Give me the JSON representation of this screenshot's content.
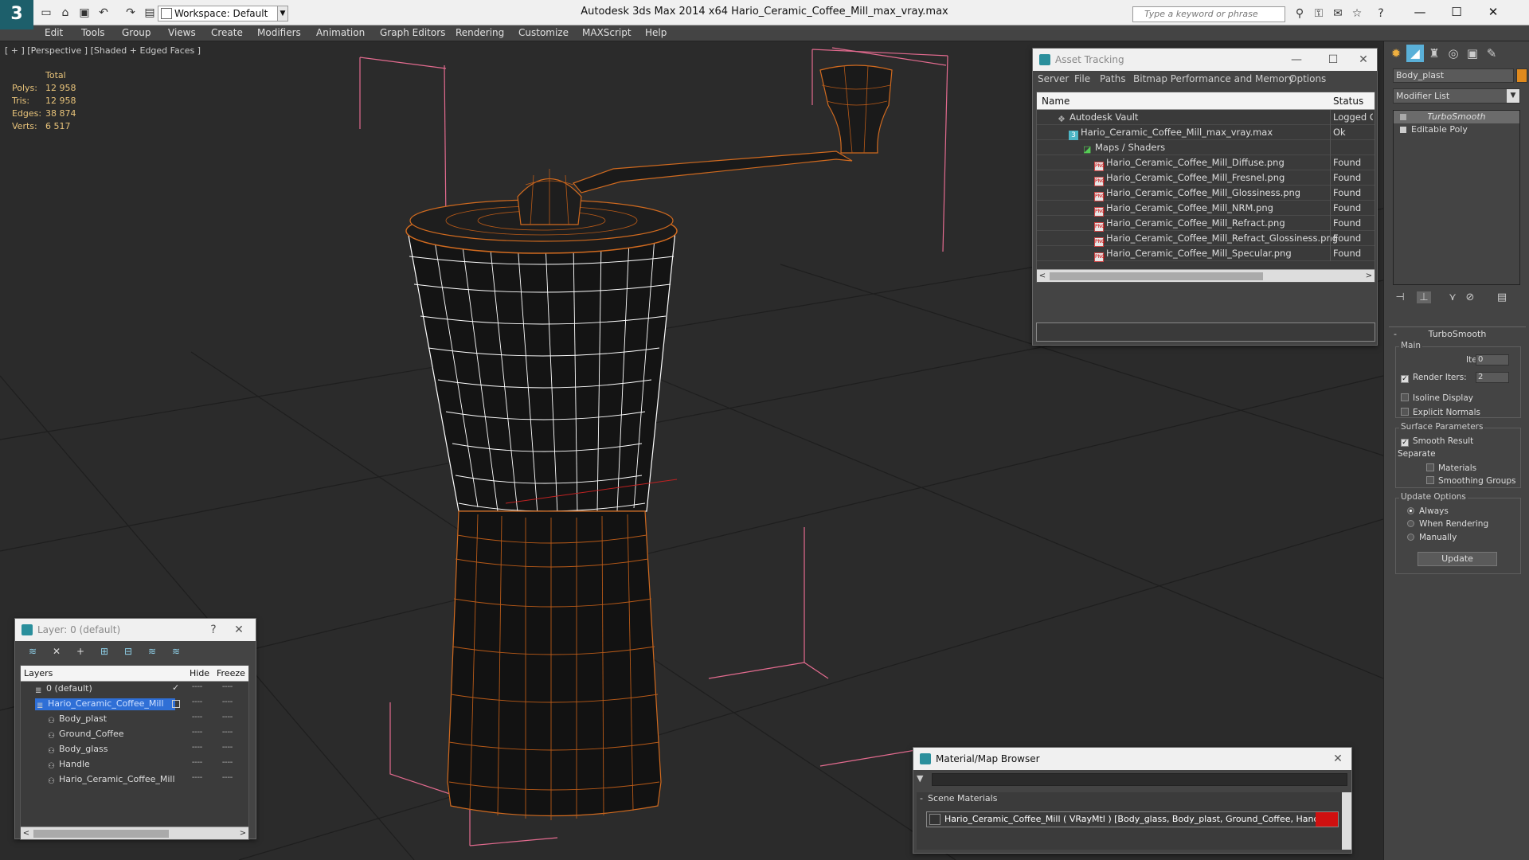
{
  "app": {
    "logo": "3",
    "title": "Autodesk 3ds Max  2014 x64      Hario_Ceramic_Coffee_Mill_max_vray.max",
    "workspace": "Workspace: Default",
    "search_placeholder": "Type a keyword or phrase"
  },
  "menus": [
    "Edit",
    "Tools",
    "Group",
    "Views",
    "Create",
    "Modifiers",
    "Animation",
    "Graph Editors",
    "Rendering",
    "Customize",
    "MAXScript",
    "Help"
  ],
  "viewport": {
    "label": "[ + ] [Perspective ] [Shaded + Edged Faces ]",
    "stats": {
      "header": "Total",
      "rows": [
        {
          "label": "Polys:",
          "value": "12 958"
        },
        {
          "label": "Tris:",
          "value": "12 958"
        },
        {
          "label": "Edges:",
          "value": "38 874"
        },
        {
          "label": "Verts:",
          "value": "6 517"
        }
      ]
    }
  },
  "asset_tracking": {
    "title": "Asset Tracking",
    "menus": [
      "Server",
      "File",
      "Paths",
      "Bitmap Performance and Memory",
      "Options"
    ],
    "col_name": "Name",
    "col_status": "Status",
    "rows": [
      {
        "name": "Autodesk Vault",
        "status": "Logged Out",
        "icon": "vault-icon"
      },
      {
        "name": "Hario_Ceramic_Coffee_Mill_max_vray.max",
        "status": "Ok",
        "icon": "max-file-icon"
      },
      {
        "name": "Maps / Shaders",
        "status": "",
        "icon": "folder-icon"
      },
      {
        "name": "Hario_Ceramic_Coffee_Mill_Diffuse.png",
        "status": "Found",
        "icon": "png-icon"
      },
      {
        "name": "Hario_Ceramic_Coffee_Mill_Fresnel.png",
        "status": "Found",
        "icon": "png-icon"
      },
      {
        "name": "Hario_Ceramic_Coffee_Mill_Glossiness.png",
        "status": "Found",
        "icon": "png-icon"
      },
      {
        "name": "Hario_Ceramic_Coffee_Mill_NRM.png",
        "status": "Found",
        "icon": "png-icon"
      },
      {
        "name": "Hario_Ceramic_Coffee_Mill_Refract.png",
        "status": "Found",
        "icon": "png-icon"
      },
      {
        "name": "Hario_Ceramic_Coffee_Mill_Refract_Glossiness.png",
        "status": "Found",
        "icon": "png-icon"
      },
      {
        "name": "Hario_Ceramic_Coffee_Mill_Specular.png",
        "status": "Found",
        "icon": "png-icon"
      }
    ]
  },
  "command_panel": {
    "object_name": "Body_plast",
    "object_color": "#e08a1e",
    "modifier_list": "Modifier List",
    "stack": [
      "TurboSmooth",
      "Editable Poly"
    ],
    "turbosmooth": {
      "title": "TurboSmooth",
      "main_label": "Main",
      "iterations_label": "Iterations:",
      "iterations_value": "0",
      "render_iters_label": "Render Iters:",
      "render_iters_value": "2",
      "isoline": "Isoline Display",
      "explicit_normals": "Explicit Normals",
      "surface_label": "Surface Parameters",
      "smooth_result": "Smooth Result",
      "separate_label": "Separate",
      "materials": "Materials",
      "smoothing_groups": "Smoothing Groups",
      "update_label": "Update Options",
      "always": "Always",
      "when_rendering": "When Rendering",
      "manually": "Manually",
      "update_button": "Update"
    }
  },
  "layer_panel": {
    "title": "Layer: 0 (default)",
    "col_layers": "Layers",
    "col_hide": "Hide",
    "col_freeze": "Freeze",
    "rows": [
      {
        "name": "0 (default)",
        "indent": 1,
        "sel": false,
        "check": true
      },
      {
        "name": "Hario_Ceramic_Coffee_Mill",
        "indent": 1,
        "sel": true,
        "check": false
      },
      {
        "name": "Body_plast",
        "indent": 2,
        "sel": false,
        "check": false
      },
      {
        "name": "Ground_Coffee",
        "indent": 2,
        "sel": false,
        "check": false
      },
      {
        "name": "Body_glass",
        "indent": 2,
        "sel": false,
        "check": false
      },
      {
        "name": "Handle",
        "indent": 2,
        "sel": false,
        "check": false
      },
      {
        "name": "Hario_Ceramic_Coffee_Mill",
        "indent": 2,
        "sel": false,
        "check": false
      }
    ]
  },
  "material_browser": {
    "title": "Material/Map Browser",
    "section": "Scene Materials",
    "item": "Hario_Ceramic_Coffee_Mill ( VRayMtl ) [Body_glass, Body_plast, Ground_Coffee, Handle]"
  }
}
